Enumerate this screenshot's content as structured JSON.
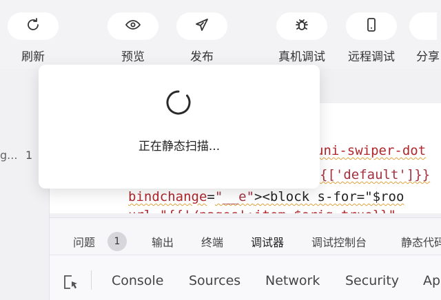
{
  "toolbar": {
    "refresh": "刷新",
    "preview": "预览",
    "publish": "发布",
    "real_device_debug": "真机调试",
    "remote_debug": "远程调试",
    "share": "分享"
  },
  "left_panel": {
    "item_label": "g...",
    "item_count": "1"
  },
  "editor": {
    "line1_tail": "uni-swiper-dot",
    "line2_tail": "{['default']}}",
    "line3_attr": "bindchange",
    "line3_value": "\"__e\"",
    "line3_tag": "><block s-for=\"$roo",
    "line4": "url=\"{{'/pages':item.$orig.true}}\""
  },
  "modal": {
    "message": "正在静态扫描..."
  },
  "bottom_tabs": {
    "problems": "问题",
    "problems_count": "1",
    "output": "输出",
    "terminal": "终端",
    "debugger": "调试器",
    "debug_console": "调试控制台",
    "static_code": "静态代码"
  },
  "devtools_tabs": {
    "console": "Console",
    "sources": "Sources",
    "network": "Network",
    "security": "Security",
    "more": "Ap"
  }
}
